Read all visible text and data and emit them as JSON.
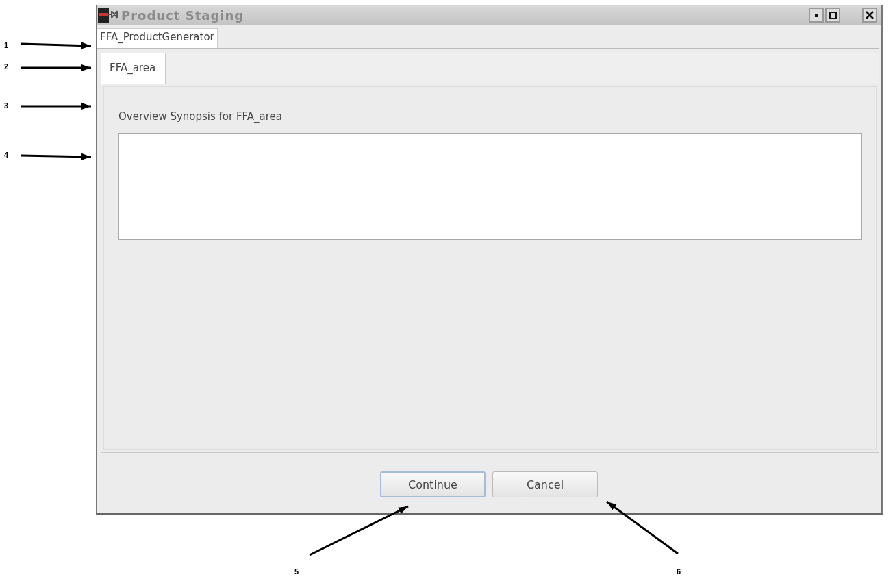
{
  "window": {
    "title": "Product Staging"
  },
  "outer_tabs": [
    {
      "label": "FFA_ProductGenerator",
      "selected": true
    }
  ],
  "inner_tabs": [
    {
      "label": "FFA_area",
      "selected": true
    }
  ],
  "synopsis": {
    "label": "Overview Synopsis for FFA_area"
  },
  "buttons": [
    {
      "label": "Continue",
      "focused": true
    },
    {
      "label": "Cancel",
      "focused": false
    }
  ],
  "callouts": [
    {
      "label": "1"
    },
    {
      "label": "2"
    },
    {
      "label": "3"
    },
    {
      "label": "4"
    },
    {
      "label": "5"
    },
    {
      "label": "6"
    }
  ]
}
